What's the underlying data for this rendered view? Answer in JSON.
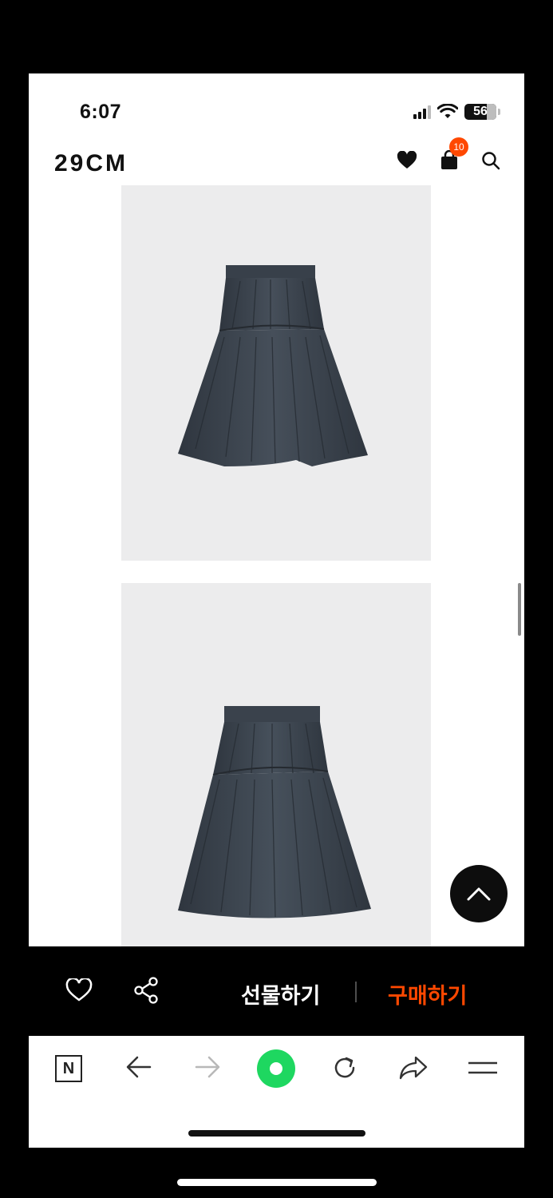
{
  "status_bar": {
    "time": "6:07",
    "battery": "56"
  },
  "header": {
    "logo": "29CM",
    "cart_count": "10"
  },
  "action_bar": {
    "gift_label": "선물하기",
    "buy_label": "구매하기"
  },
  "browser_bar": {
    "n_label": "N"
  },
  "colors": {
    "accent": "#ff4800",
    "action_bar_bg": "#000000",
    "image_bg": "#ececed",
    "browser_home_icon": "#1ed760"
  }
}
